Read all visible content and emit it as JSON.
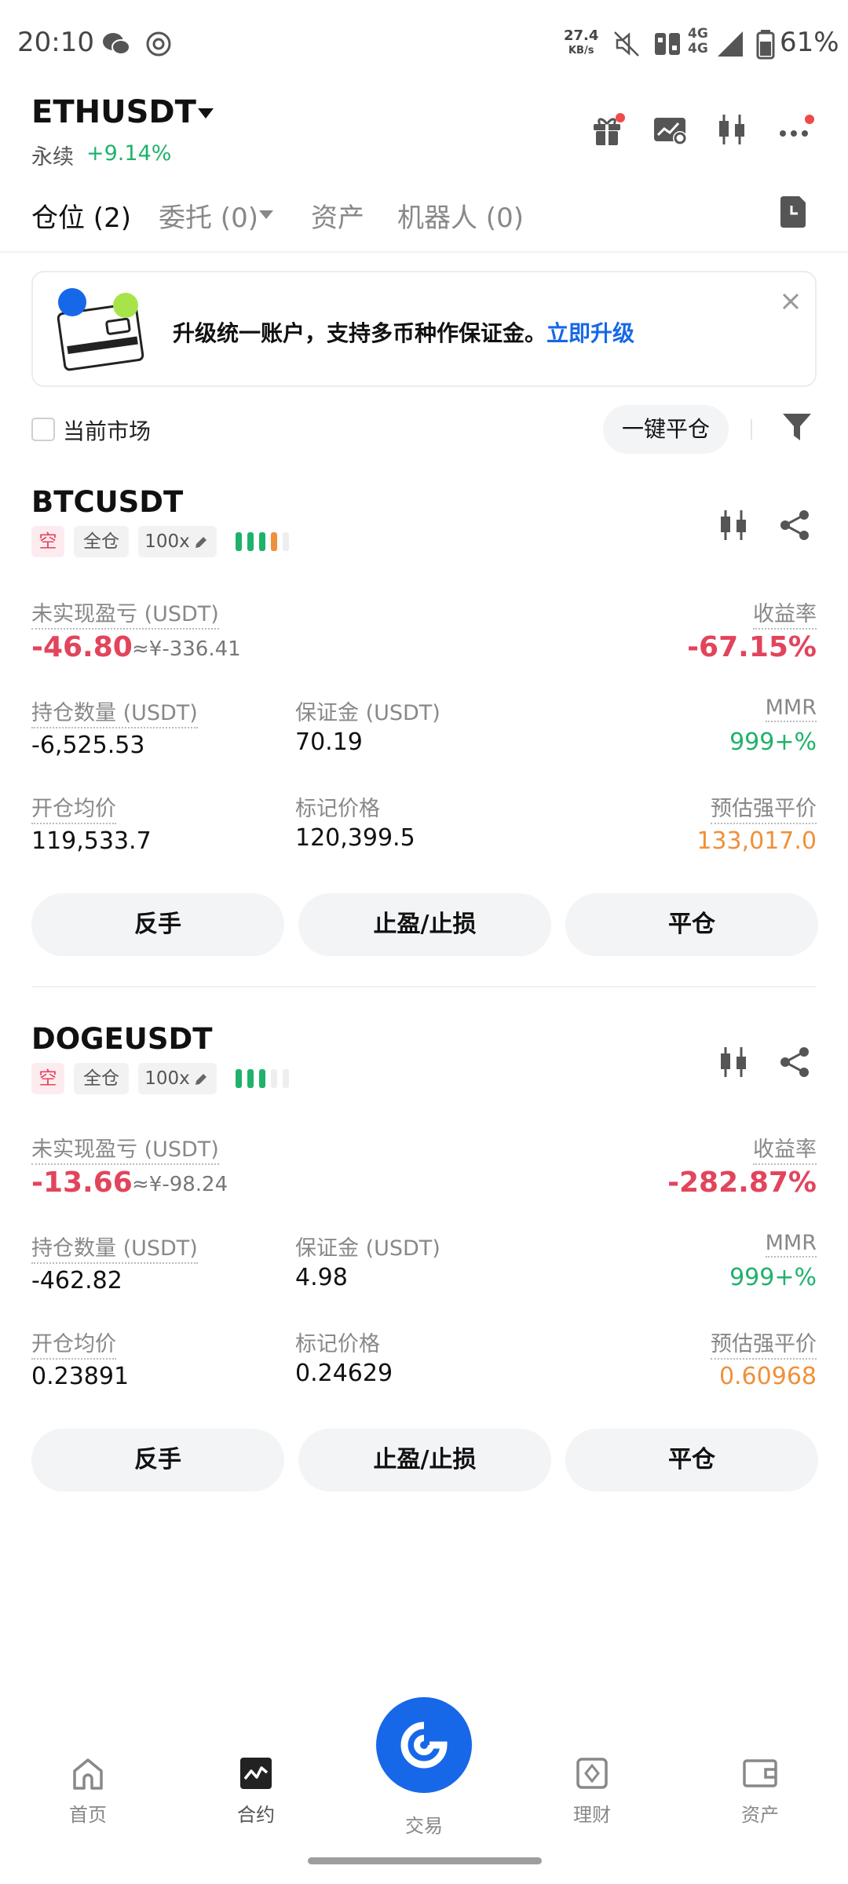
{
  "status_bar": {
    "time": "20:10",
    "speed_value": "27.4",
    "speed_unit": "KB/s",
    "network_1": "4G",
    "network_2": "4G",
    "battery": "61%"
  },
  "header": {
    "symbol": "ETHUSDT",
    "type": "永续",
    "change": "+9.14%"
  },
  "tabs": {
    "positions": "仓位 (2)",
    "orders": "委托 (0)",
    "assets": "资产",
    "bots": "机器人 (0)"
  },
  "banner": {
    "text": "升级统一账户，支持多币种作保证金。",
    "link": "立即升级"
  },
  "filter": {
    "current_market": "当前市场",
    "close_all": "一键平仓"
  },
  "labels": {
    "unrealized_pnl": "未实现盈亏 (USDT)",
    "roe": "收益率",
    "size": "持仓数量 (USDT)",
    "margin": "保证金 (USDT)",
    "mmr": "MMR",
    "entry_price": "开仓均价",
    "mark_price": "标记价格",
    "liq_price": "预估强平价",
    "reverse": "反手",
    "tpsl": "止盈/止损",
    "close": "平仓",
    "short": "空",
    "cross": "全仓"
  },
  "positions": [
    {
      "symbol": "BTCUSDT",
      "leverage": "100x",
      "level_bars_filled": 3,
      "level_bars_warn": 1,
      "pnl": "-46.80",
      "pnl_cny": "≈¥-336.41",
      "roe": "-67.15%",
      "size": "-6,525.53",
      "margin": "70.19",
      "mmr": "999+%",
      "entry_price": "119,533.7",
      "mark_price": "120,399.5",
      "liq_price": "133,017.0"
    },
    {
      "symbol": "DOGEUSDT",
      "leverage": "100x",
      "level_bars_filled": 3,
      "level_bars_warn": 0,
      "pnl": "-13.66",
      "pnl_cny": "≈¥-98.24",
      "roe": "-282.87%",
      "size": "-462.82",
      "margin": "4.98",
      "mmr": "999+%",
      "entry_price": "0.23891",
      "mark_price": "0.24629",
      "liq_price": "0.60968"
    }
  ],
  "nav": {
    "home": "首页",
    "futures": "合约",
    "trade": "交易",
    "earn": "理财",
    "assets": "资产"
  },
  "colors": {
    "accent": "#1768e8",
    "up": "#20b26c",
    "down": "#e2445c",
    "warn": "#f0903a"
  }
}
